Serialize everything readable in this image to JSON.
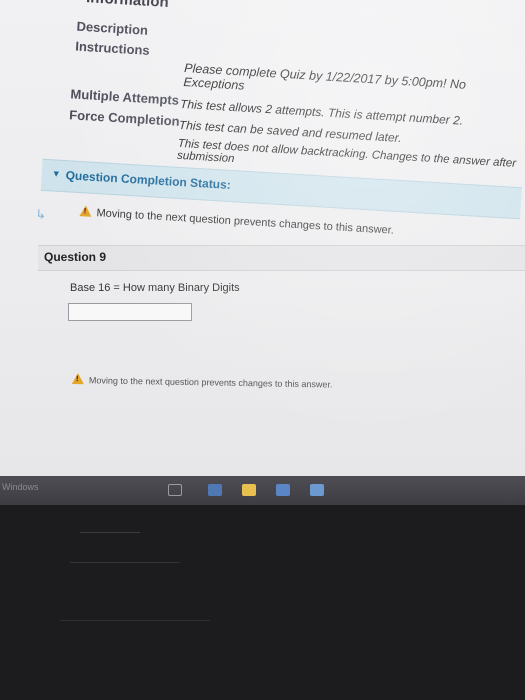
{
  "info": {
    "heading": "Information",
    "description_label": "Description",
    "instructions_label": "Instructions",
    "instructions_text": "Please complete Quiz by 1/22/2017 by 5:00pm! No Exceptions",
    "multiple_attempts_label": "Multiple Attempts",
    "multiple_attempts_text": "This test allows 2 attempts. This is attempt number 2.",
    "force_completion_label": "Force Completion",
    "force_completion_text": "This test can be saved and resumed later.",
    "backtracking_text": "This test does not allow backtracking. Changes to the answer after submission"
  },
  "status": {
    "label": "Question Completion Status:"
  },
  "warnings": {
    "top": "Moving to the next question prevents changes to this answer.",
    "bottom": "Moving to the next question prevents changes to this answer."
  },
  "question": {
    "title": "Question 9",
    "text": "Base 16 = How many Binary Digits",
    "answer_value": ""
  },
  "taskbar": {
    "windows_label": "Windows"
  },
  "colors": {
    "status_bg": "#cfe3ec",
    "status_text": "#1e6a9a",
    "warning": "#e2a62a"
  }
}
